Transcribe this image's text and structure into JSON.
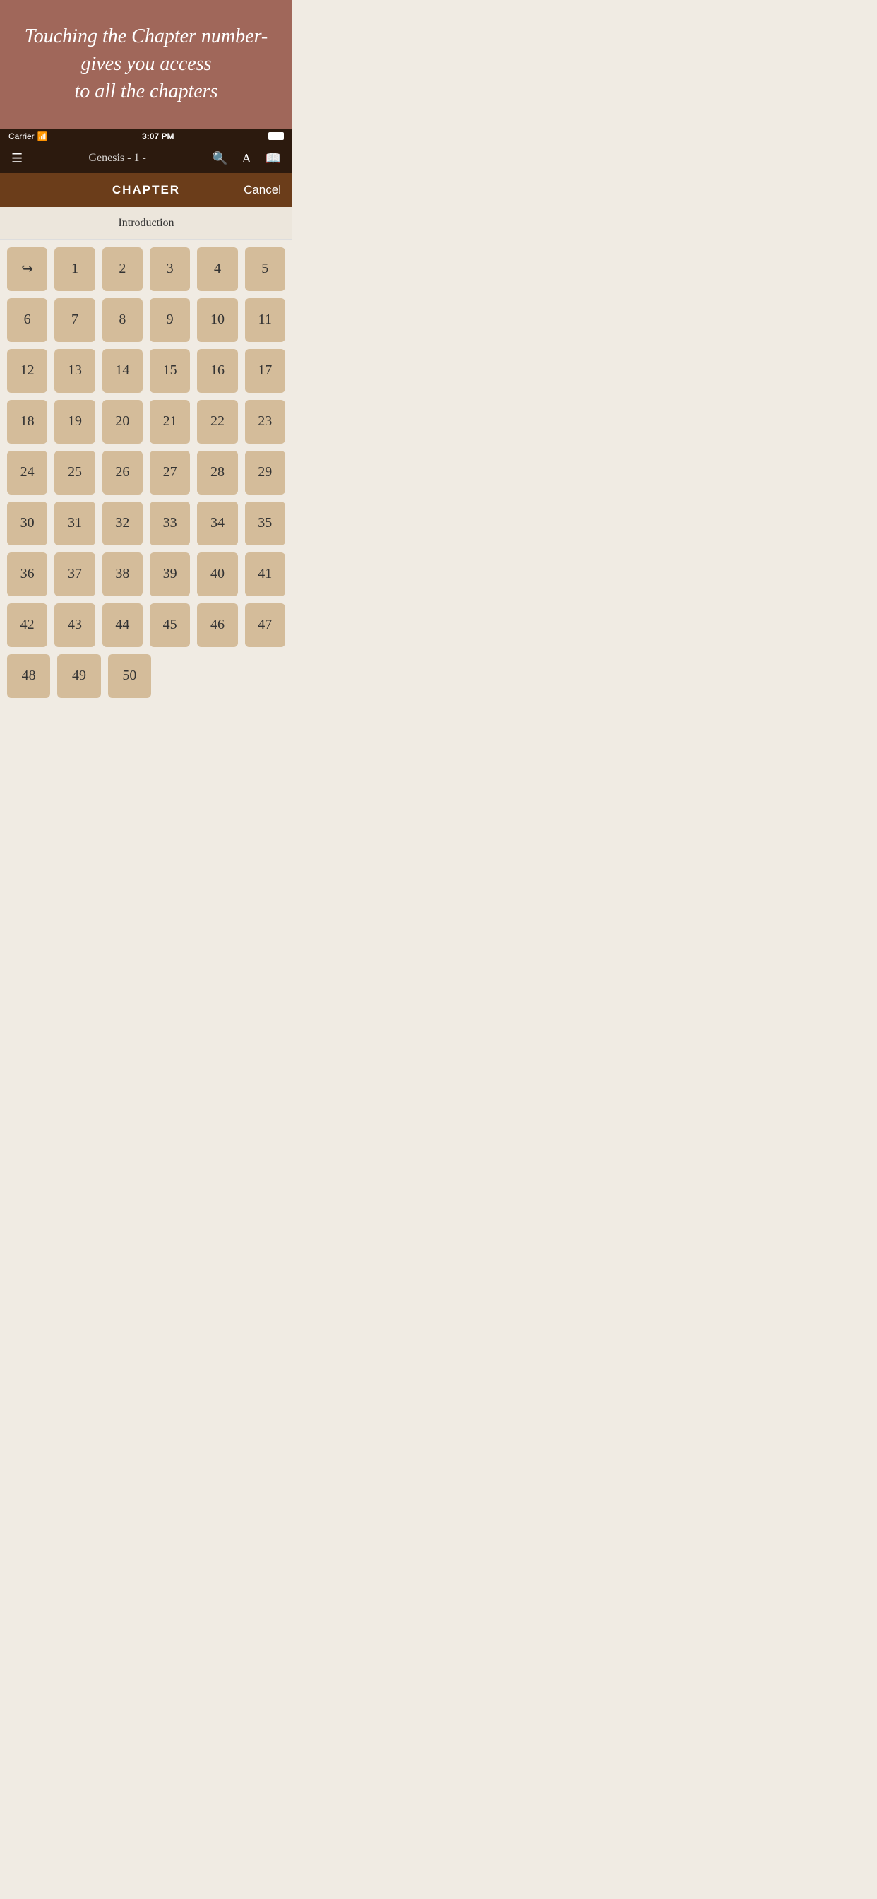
{
  "tooltip": {
    "text": "Touching the Chapter number-\ngives you access\nto all the chapters"
  },
  "statusBar": {
    "carrier": "Carrier",
    "time": "3:07 PM"
  },
  "navBar": {
    "title": "Genesis - 1 -"
  },
  "header": {
    "title": "CHAPTER",
    "cancel": "Cancel"
  },
  "introduction": {
    "label": "Introduction"
  },
  "chapters": [
    {
      "label": "↪",
      "isShare": true
    },
    {
      "label": "1"
    },
    {
      "label": "2"
    },
    {
      "label": "3"
    },
    {
      "label": "4"
    },
    {
      "label": "5"
    },
    {
      "label": "6"
    },
    {
      "label": "7"
    },
    {
      "label": "8"
    },
    {
      "label": "9"
    },
    {
      "label": "10"
    },
    {
      "label": "11"
    },
    {
      "label": "12"
    },
    {
      "label": "13"
    },
    {
      "label": "14"
    },
    {
      "label": "15"
    },
    {
      "label": "16"
    },
    {
      "label": "17"
    },
    {
      "label": "18"
    },
    {
      "label": "19"
    },
    {
      "label": "20"
    },
    {
      "label": "21"
    },
    {
      "label": "22"
    },
    {
      "label": "23"
    },
    {
      "label": "24"
    },
    {
      "label": "25"
    },
    {
      "label": "26"
    },
    {
      "label": "27"
    },
    {
      "label": "28"
    },
    {
      "label": "29"
    },
    {
      "label": "30"
    },
    {
      "label": "31"
    },
    {
      "label": "32"
    },
    {
      "label": "33"
    },
    {
      "label": "34"
    },
    {
      "label": "35"
    },
    {
      "label": "36"
    },
    {
      "label": "37"
    },
    {
      "label": "38"
    },
    {
      "label": "39"
    },
    {
      "label": "40"
    },
    {
      "label": "41"
    },
    {
      "label": "42"
    },
    {
      "label": "43"
    },
    {
      "label": "44"
    },
    {
      "label": "45"
    },
    {
      "label": "46"
    },
    {
      "label": "47"
    },
    {
      "label": "48"
    },
    {
      "label": "49"
    },
    {
      "label": "50"
    }
  ],
  "colors": {
    "tooltipBg": "#a0675a",
    "headerBg": "#6b3d1a",
    "navBg": "#2c1a0e",
    "chapterBtn": "#d4bc9a",
    "introBg": "#ece6dc",
    "pageBg": "#f0ebe3"
  }
}
